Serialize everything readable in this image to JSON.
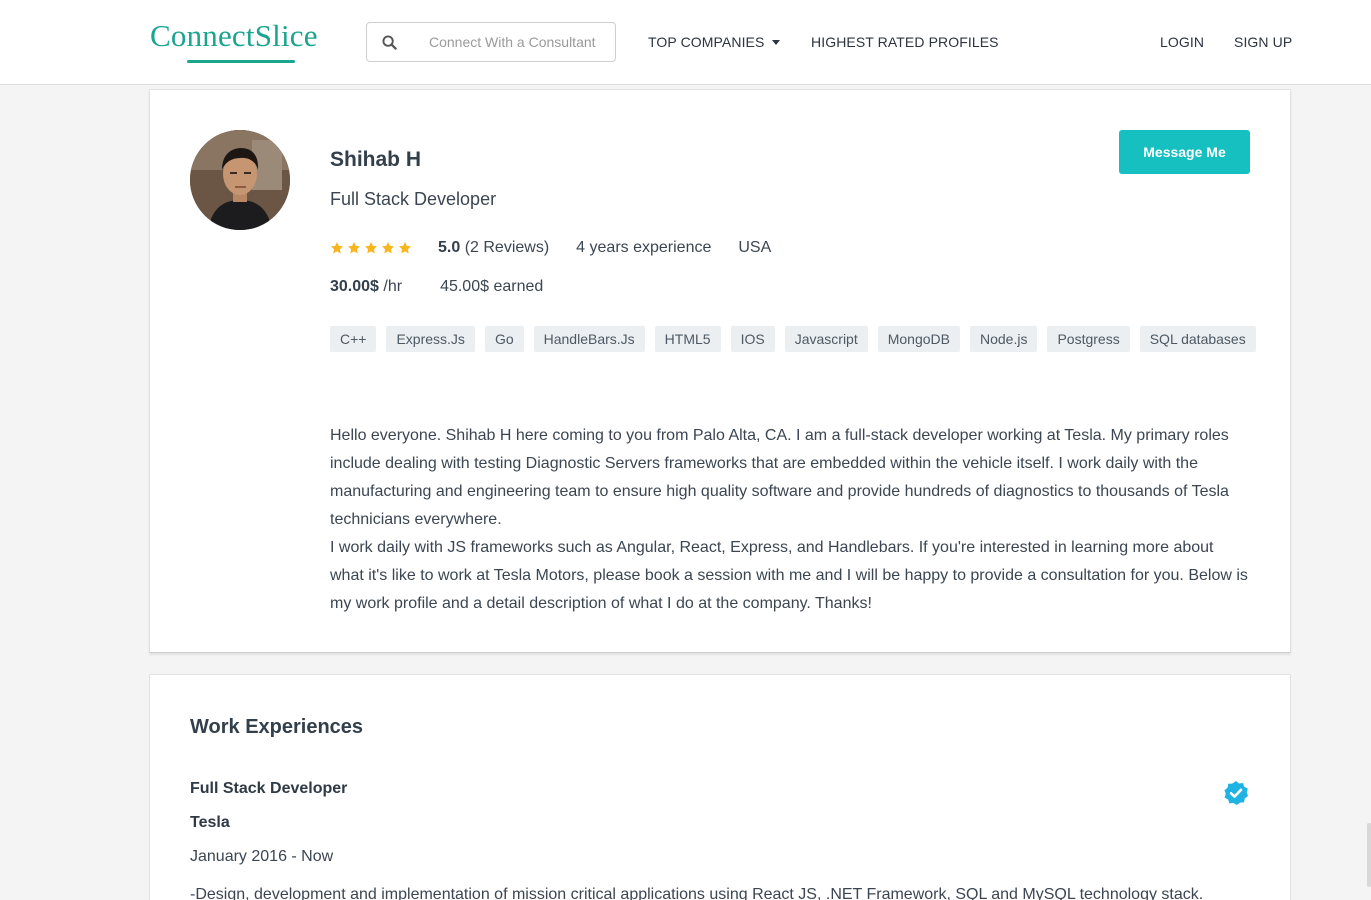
{
  "brand": {
    "name": "ConnectSlice",
    "color": "#1aa58f"
  },
  "search": {
    "placeholder": "Connect With a Consultant",
    "value": "",
    "icon": "search-icon"
  },
  "nav": {
    "top_companies": "TOP COMPANIES",
    "highest_rated": "HIGHEST RATED PROFILES",
    "login": "LOGIN",
    "signup": "SIGN UP"
  },
  "profile": {
    "name": "Shihab H",
    "title": "Full Stack Developer",
    "message_button": "Message Me",
    "accent_color": "#16bfc0",
    "rating_stars": 5,
    "rating_value": "5.0",
    "reviews": "(2 Reviews)",
    "experience": "4 years experience",
    "location": "USA",
    "hourly_rate": "30.00$",
    "hourly_unit": "/hr",
    "earned": "45.00$ earned",
    "skills": [
      "C++",
      "Express.Js",
      "Go",
      "HandleBars.Js",
      "HTML5",
      "IOS",
      "Javascript",
      "MongoDB",
      "Node.js",
      "Postgress",
      "SQL databases"
    ],
    "bio_paragraphs": [
      "Hello everyone. Shihab H here coming to you from Palo Alta, CA. I am a  full-stack developer working at Tesla. My primary roles include dealing with testing Diagnostic Servers frameworks that are embedded within the vehicle itself. I work daily with the manufacturing and engineering team to ensure high quality software and provide hundreds of diagnostics to thousands of Tesla technicians everywhere.",
      "I work daily with JS frameworks such as Angular, React, Express, and Handlebars. If you're interested in learning more about what it's like to work at Tesla Motors, please book a session with me and I will be happy to provide a consultation for you. Below is my work profile and a detail description of what I do at the company. Thanks!"
    ]
  },
  "work": {
    "section_title": "Work Experiences",
    "items": [
      {
        "title": "Full Stack Developer",
        "company": "Tesla",
        "dates": "January 2016 - Now",
        "description": "-Design, development and implementation of mission critical applications using React JS, .NET Framework, SQL and MySQL technology stack.",
        "verified_icon": "verified-check-icon"
      }
    ]
  }
}
